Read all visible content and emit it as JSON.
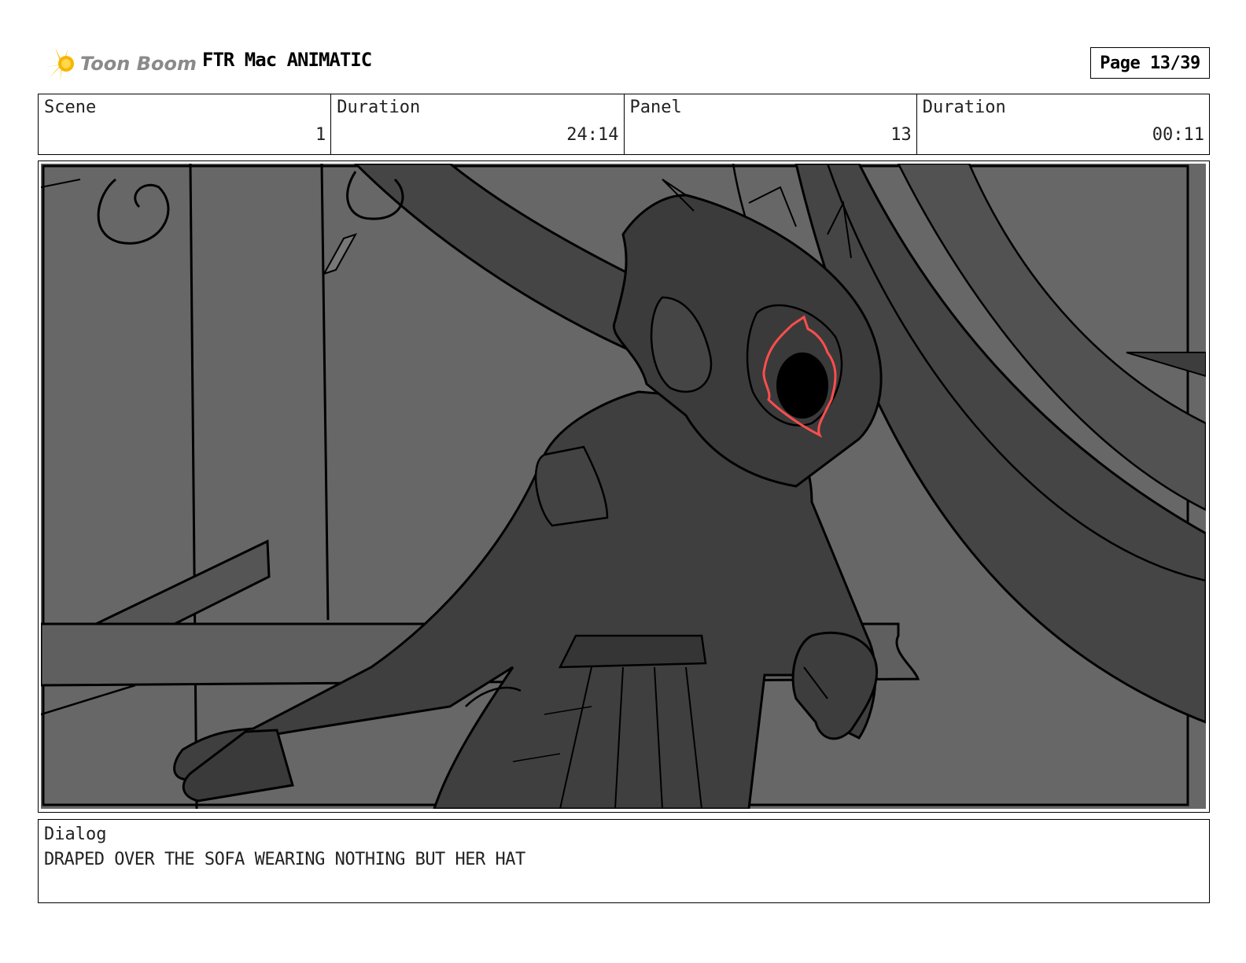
{
  "header": {
    "logo_text": "Toon Boom",
    "project_title": "FTR Mac ANIMATIC",
    "page": "Page 13/39"
  },
  "info": {
    "scene_label": "Scene",
    "scene_value": "1",
    "scene_duration_label": "Duration",
    "scene_duration_value": "24:14",
    "panel_label": "Panel",
    "panel_value": "13",
    "panel_duration_label": "Duration",
    "panel_duration_value": "00:11"
  },
  "panel_image": {
    "icon": "storyboard-sketch-hooded-figure",
    "colors": {
      "background_light": "#6b6b6b",
      "background_dark": "#4a4a4a",
      "figure": "#3f3f3f",
      "eye_outline": "#ff4d4d",
      "line": "#000000"
    }
  },
  "dialog": {
    "label": "Dialog",
    "text": "DRAPED OVER THE SOFA WEARING NOTHING BUT HER HAT"
  }
}
